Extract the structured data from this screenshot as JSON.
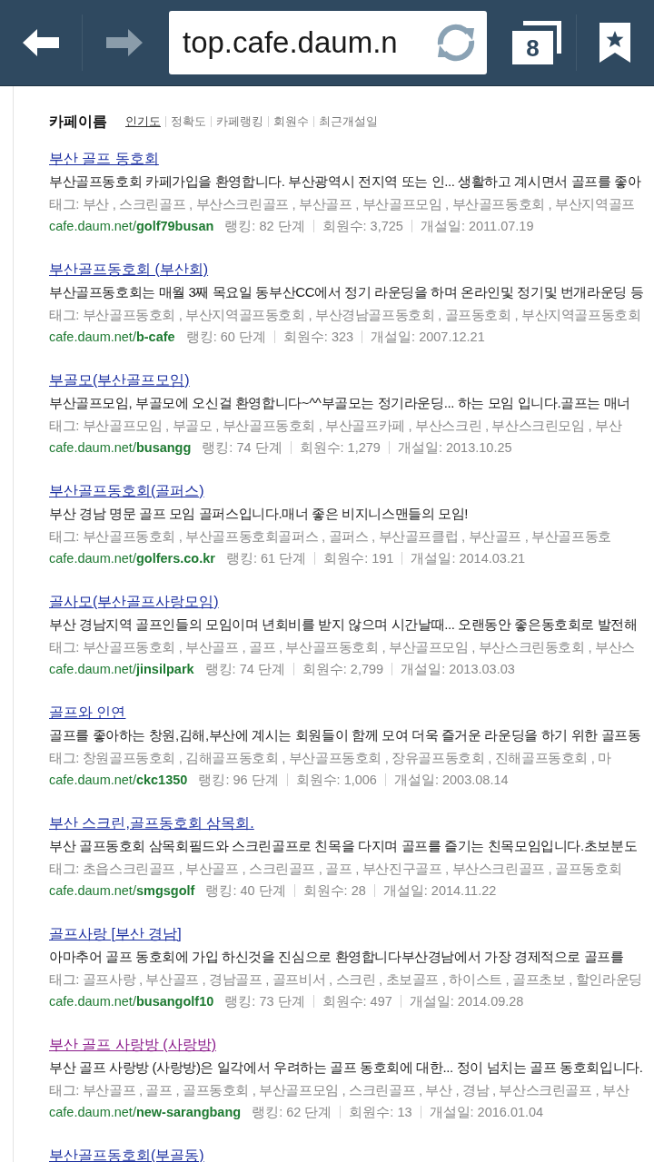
{
  "toolbar": {
    "back": {
      "disabled": false
    },
    "forward": {
      "disabled": true
    },
    "address": "top.cafe.daum.n",
    "tab_count": "8"
  },
  "heading": "카페이름",
  "sort_options": [
    {
      "label": "인기도",
      "selected": true
    },
    {
      "label": "정확도",
      "selected": false
    },
    {
      "label": "카페랭킹",
      "selected": false
    },
    {
      "label": "회원수",
      "selected": false
    },
    {
      "label": "최근개설일",
      "selected": false
    }
  ],
  "results": [
    {
      "title": "부산 골프 동호회",
      "visited": false,
      "description": "부산골프동호회 카페가입을 환영합니다. 부산광역시 전지역 또는 인... 생활하고 계시면서 골프를 좋아",
      "tags": "태그: 부산 , 스크린골프 , 부산스크린골프 , 부산골프 , 부산골프모임 , 부산골프동호회 , 부산지역골프",
      "url_base": "cafe.daum.net/",
      "url_id": "golf79busan",
      "ranking": "랭킹: 82 단계",
      "members": "회원수: 3,725",
      "founded": "개설일: 2011.07.19"
    },
    {
      "title": "부산골프동호회 (부산회)",
      "visited": false,
      "description": "부산골프동호회는 매월 3째 목요일 동부산CC에서 정기 라운딩을 하며 온라인및 정기및 번개라운딩 등",
      "tags": "태그: 부산골프동호회 , 부산지역골프동호회 , 부산경남골프동호회 , 골프동호회 , 부산지역골프동호회",
      "url_base": "cafe.daum.net/",
      "url_id": "b-cafe",
      "ranking": "랭킹: 60 단계",
      "members": "회원수: 323",
      "founded": "개설일: 2007.12.21"
    },
    {
      "title": "부골모(부산골프모임)",
      "visited": false,
      "description": "부산골프모임, 부골모에 오신걸 환영합니다~^^부골모는 정기라운딩... 하는 모임 입니다.골프는 매너",
      "tags": "태그: 부산골프모임 , 부골모 , 부산골프동호회 , 부산골프카페 , 부산스크린 , 부산스크린모임 , 부산",
      "url_base": "cafe.daum.net/",
      "url_id": "busangg",
      "ranking": "랭킹: 74 단계",
      "members": "회원수: 1,279",
      "founded": "개설일: 2013.10.25"
    },
    {
      "title": "부산골프동호회(골퍼스)",
      "visited": false,
      "description": "부산 경남 명문 골프 모임 골퍼스입니다.매너 좋은 비지니스맨들의 모임!",
      "tags": "태그: 부산골프동호회 , 부산골프동호회골퍼스 , 골퍼스 , 부산골프클럽 , 부산골프 , 부산골프동호",
      "url_base": "cafe.daum.net/",
      "url_id": "golfers.co.kr",
      "ranking": "랭킹: 61 단계",
      "members": "회원수: 191",
      "founded": "개설일: 2014.03.21"
    },
    {
      "title": "골사모(부산골프사랑모임)",
      "visited": false,
      "description": "부산 경남지역 골프인들의 모임이며 년회비를 받지 않으며 시간날때... 오랜동안 좋은동호회로 발전해",
      "tags": "태그: 부산골프동호회 , 부산골프 , 골프 , 부산골프동호회 , 부산골프모임 , 부산스크린동호회 , 부산스",
      "url_base": "cafe.daum.net/",
      "url_id": "jinsilpark",
      "ranking": "랭킹: 74 단계",
      "members": "회원수: 2,799",
      "founded": "개설일: 2013.03.03"
    },
    {
      "title": "골프와 인연",
      "visited": false,
      "description": "골프를 좋아하는 창원,김해,부산에 계시는 회원들이 함께 모여 더욱 즐거운 라운딩을 하기 위한 골프동",
      "tags": "태그: 창원골프동호회 , 김해골프동호회 , 부산골프동호회 , 장유골프동호회 , 진해골프동호회 , 마",
      "url_base": "cafe.daum.net/",
      "url_id": "ckc1350",
      "ranking": "랭킹: 96 단계",
      "members": "회원수: 1,006",
      "founded": "개설일: 2003.08.14"
    },
    {
      "title": "부산 스크린,골프동호회 삼목회.",
      "visited": false,
      "description": "부산 골프동호회 삼목회필드와 스크린골프로 친목을 다지며 골프를 즐기는 친목모임입니다.초보분도",
      "tags": "태그: 초읍스크린골프 , 부산골프 , 스크린골프 , 골프 , 부산진구골프 , 부산스크린골프 , 골프동호회",
      "url_base": "cafe.daum.net/",
      "url_id": "smgsgolf",
      "ranking": "랭킹: 40 단계",
      "members": "회원수: 28",
      "founded": "개설일: 2014.11.22"
    },
    {
      "title": "골프사랑 [부산 경남]",
      "visited": false,
      "description": "아마추어 골프 동호회에 가입 하신것을 진심으로 환영합니다부산경남에서 가장 경제적으로 골프를",
      "tags": "태그: 골프사랑 , 부산골프 , 경남골프 , 골프비서 , 스크린 , 초보골프 , 하이스트 , 골프초보 , 할인라운딩",
      "url_base": "cafe.daum.net/",
      "url_id": "busangolf10",
      "ranking": "랭킹: 73 단계",
      "members": "회원수: 497",
      "founded": "개설일: 2014.09.28"
    },
    {
      "title": "부산 골프 사랑방 (사랑방)",
      "visited": true,
      "description": "부산 골프 사랑방 (사랑방)은 일각에서 우려하는 골프 동호회에 대한... 정이 넘치는 골프 동호회입니다.",
      "tags": "태그: 부산골프 , 골프 , 골프동호회 , 부산골프모임 , 스크린골프 , 부산 , 경남 , 부산스크린골프 , 부산",
      "url_base": "cafe.daum.net/",
      "url_id": "new-sarangbang",
      "ranking": "랭킹: 62 단계",
      "members": "회원수: 13",
      "founded": "개설일: 2016.01.04"
    },
    {
      "title": "부산골프동호회(부골동)",
      "visited": false
    }
  ]
}
